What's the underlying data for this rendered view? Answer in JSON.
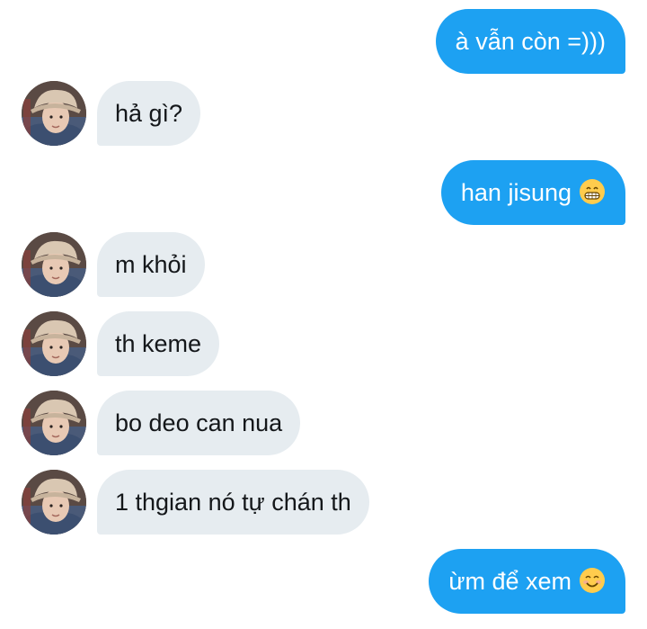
{
  "messages": [
    {
      "direction": "outgoing",
      "text": "à vẫn còn =)))"
    },
    {
      "direction": "incoming",
      "text": "hả gì?"
    },
    {
      "direction": "outgoing",
      "text": "han jisung",
      "emoji": "grinning-face-emoji"
    },
    {
      "direction": "incoming",
      "text": "m khỏi"
    },
    {
      "direction": "incoming",
      "text": "th keme"
    },
    {
      "direction": "incoming",
      "text": "bo deo can nua"
    },
    {
      "direction": "incoming",
      "text": "1 thgian nó tự chán th"
    },
    {
      "direction": "outgoing",
      "text": "ừm để xem",
      "emoji": "smiling-face-emoji"
    }
  ],
  "colors": {
    "outgoing_bubble": "#1da1f2",
    "incoming_bubble": "#e6ecf0",
    "outgoing_text": "#ffffff",
    "incoming_text": "#14171a"
  }
}
